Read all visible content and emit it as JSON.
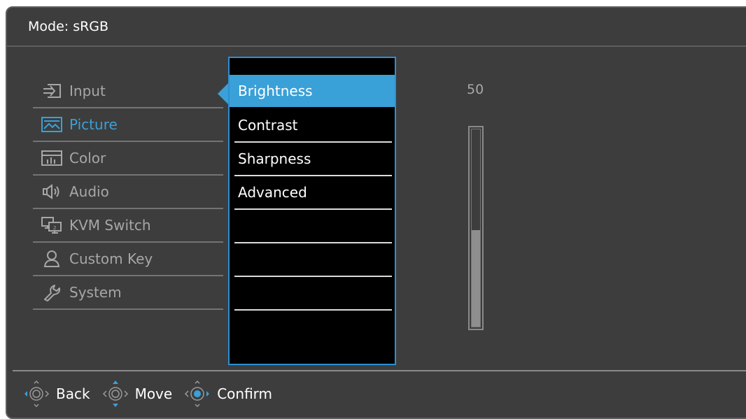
{
  "header": {
    "title": "Mode: sRGB"
  },
  "left_menu": {
    "items": [
      {
        "label": "Input",
        "icon": "input-icon",
        "active": false
      },
      {
        "label": "Picture",
        "icon": "picture-icon",
        "active": true
      },
      {
        "label": "Color",
        "icon": "color-icon",
        "active": false
      },
      {
        "label": "Audio",
        "icon": "audio-icon",
        "active": false
      },
      {
        "label": "KVM Switch",
        "icon": "kvm-switch-icon",
        "active": false
      },
      {
        "label": "Custom Key",
        "icon": "custom-key-icon",
        "active": false
      },
      {
        "label": "System",
        "icon": "system-icon",
        "active": false
      }
    ]
  },
  "submenu": {
    "items": [
      {
        "label": "Brightness",
        "selected": true
      },
      {
        "label": "Contrast",
        "selected": false
      },
      {
        "label": "Sharpness",
        "selected": false
      },
      {
        "label": "Advanced",
        "selected": false
      }
    ]
  },
  "value": {
    "label": "50",
    "level": 0.5
  },
  "footer": {
    "back": "Back",
    "move": "Move",
    "confirm": "Confirm"
  },
  "colors": {
    "accent": "#3aa0d8",
    "background": "#3d3d3d",
    "submenu_bg": "#000000",
    "text_dim": "#a7a7a7"
  }
}
